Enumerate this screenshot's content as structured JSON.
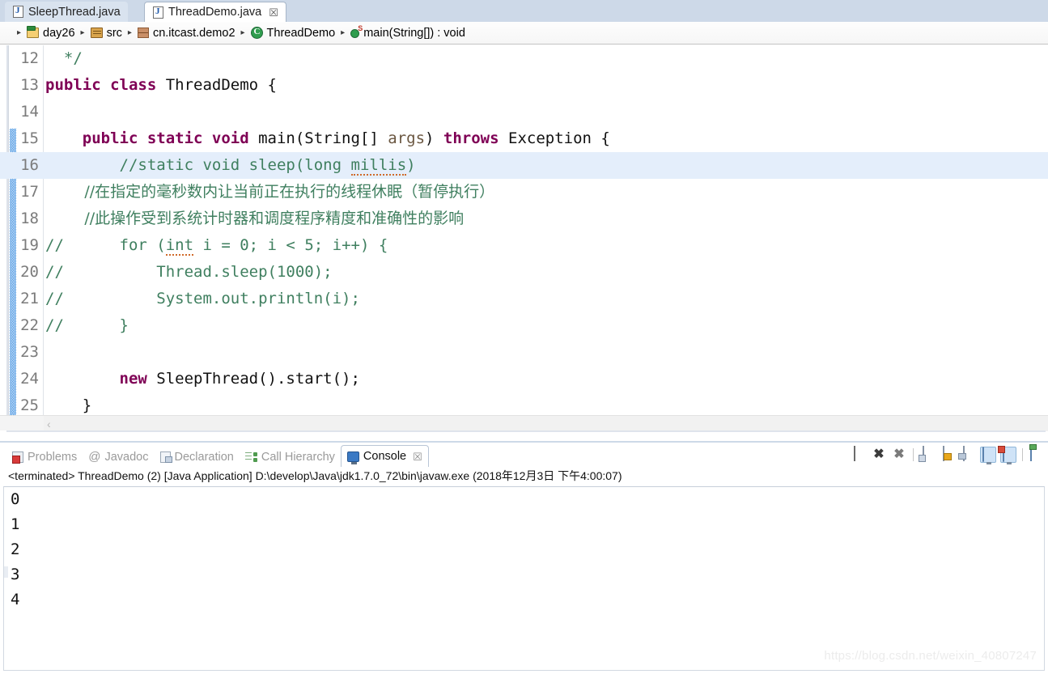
{
  "editor_tabs": [
    {
      "label": "SleepThread.java",
      "icon": "java-file-icon",
      "active": false,
      "closable": false
    },
    {
      "label": "ThreadDemo.java",
      "icon": "java-file-icon",
      "active": true,
      "closable": true,
      "close_glyph": "☒"
    }
  ],
  "breadcrumb": {
    "lead_arrow": "▸",
    "separator": "▸",
    "items": [
      {
        "label": "day26",
        "icon": "project-folder-icon"
      },
      {
        "label": "src",
        "icon": "source-folder-icon"
      },
      {
        "label": "cn.itcast.demo2",
        "icon": "package-icon"
      },
      {
        "label": "ThreadDemo",
        "icon": "class-icon"
      },
      {
        "label": "main(String[]) : void",
        "icon": "static-method-icon"
      }
    ]
  },
  "code": {
    "highlighted_line": 16,
    "lines": [
      {
        "no": "12",
        "segments": [
          {
            "t": "  */",
            "c": "cmt"
          }
        ]
      },
      {
        "no": "13",
        "segments": [
          {
            "t": "public class ",
            "c": "kw"
          },
          {
            "t": "ThreadDemo {",
            "c": "plain"
          }
        ]
      },
      {
        "no": "14",
        "segments": [
          {
            "t": "",
            "c": "plain"
          }
        ]
      },
      {
        "no": "15",
        "segments": [
          {
            "t": "    ",
            "c": "plain"
          },
          {
            "t": "public static void ",
            "c": "kw"
          },
          {
            "t": "main(String[] ",
            "c": "plain"
          },
          {
            "t": "args",
            "c": "par"
          },
          {
            "t": ") ",
            "c": "plain"
          },
          {
            "t": "throws ",
            "c": "kw"
          },
          {
            "t": "Exception {",
            "c": "plain"
          }
        ]
      },
      {
        "no": "16",
        "segments": [
          {
            "t": "        //static void sleep(long ",
            "c": "cmt"
          },
          {
            "t": "millis",
            "c": "cmt-squig"
          },
          {
            "t": ")",
            "c": "cmt"
          }
        ]
      },
      {
        "no": "17",
        "segments": [
          {
            "t": "        //在指定的毫秒数内让当前正在执行的线程休眠（暂停执行）",
            "c": "cmtz"
          }
        ]
      },
      {
        "no": "18",
        "segments": [
          {
            "t": "        //此操作受到系统计时器和调度程序精度和准确性的影响",
            "c": "cmtz"
          }
        ]
      },
      {
        "no": "19",
        "segments": [
          {
            "t": "//      for (",
            "c": "cmt"
          },
          {
            "t": "int",
            "c": "cmt-squig"
          },
          {
            "t": " i = 0; i < 5; i++) {",
            "c": "cmt"
          }
        ]
      },
      {
        "no": "20",
        "segments": [
          {
            "t": "//          Thread.sleep(1000);",
            "c": "cmt"
          }
        ]
      },
      {
        "no": "21",
        "segments": [
          {
            "t": "//          System.out.println(i);",
            "c": "cmt"
          }
        ]
      },
      {
        "no": "22",
        "segments": [
          {
            "t": "//      }",
            "c": "cmt"
          }
        ]
      },
      {
        "no": "23",
        "segments": [
          {
            "t": "",
            "c": "plain"
          }
        ]
      },
      {
        "no": "24",
        "segments": [
          {
            "t": "        ",
            "c": "plain"
          },
          {
            "t": "new ",
            "c": "kw"
          },
          {
            "t": "SleepThread().start();",
            "c": "plain"
          }
        ]
      },
      {
        "no": "25",
        "segments": [
          {
            "t": "    }",
            "c": "plain"
          }
        ]
      }
    ],
    "hscroll_arrow": "‹"
  },
  "console_panel": {
    "tabs": [
      {
        "label": "Problems",
        "icon": "problems-icon",
        "active": false
      },
      {
        "label": "Javadoc",
        "icon": "javadoc-icon",
        "active": false
      },
      {
        "label": "Declaration",
        "icon": "declaration-icon",
        "active": false
      },
      {
        "label": "Call Hierarchy",
        "icon": "call-hierarchy-icon",
        "active": false
      },
      {
        "label": "Console",
        "icon": "console-icon",
        "active": true,
        "close_glyph": "☒"
      }
    ],
    "toolbar": [
      {
        "name": "terminate-button",
        "glyph": ""
      },
      {
        "name": "remove-launch-button",
        "glyph": "✖"
      },
      {
        "name": "remove-all-terminated-button",
        "glyph": "✖"
      },
      {
        "name": "clear-console-button",
        "glyph": ""
      },
      {
        "name": "scroll-lock-button",
        "glyph": ""
      },
      {
        "name": "pin-console-button",
        "glyph": ""
      },
      {
        "name": "display-selected-console-button",
        "glyph": ""
      },
      {
        "name": "open-console-button",
        "glyph": ""
      },
      {
        "name": "new-console-view-button",
        "glyph": ""
      }
    ],
    "terminated_line": "<terminated> ThreadDemo (2) [Java Application] D:\\develop\\Java\\jdk1.7.0_72\\bin\\javaw.exe (2018年12月3日 下午4:00:07)",
    "output": [
      "0",
      "1",
      "2",
      "3",
      "4"
    ]
  },
  "watermark": "https://blog.csdn.net/weixin_40807247",
  "colors": {
    "tabbar_bg": "#cdd9e8",
    "keyword": "#7f0055",
    "comment": "#3f7f5f",
    "parameter": "#6a5640",
    "line_highlight": "#e4eefb",
    "change_bar": "#1f7ddb"
  }
}
